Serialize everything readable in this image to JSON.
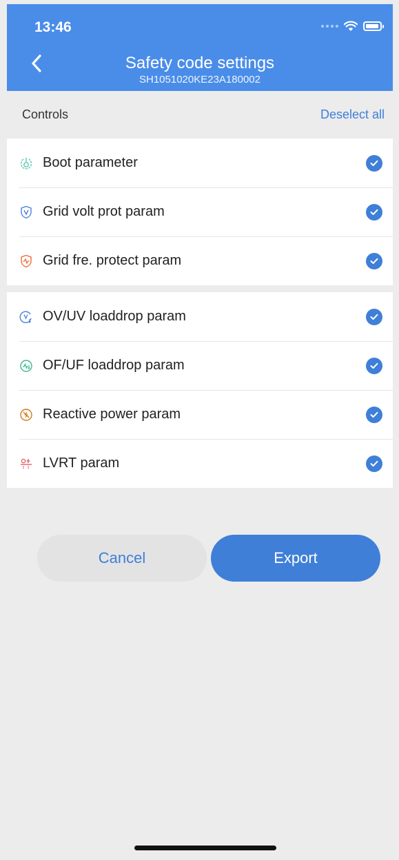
{
  "status_bar": {
    "time": "13:46"
  },
  "header": {
    "title": "Safety code settings",
    "subtitle": "SH1051020KE23A180002"
  },
  "section": {
    "label": "Controls",
    "action": "Deselect all"
  },
  "group1": [
    {
      "label": "Boot parameter",
      "icon": "power-plug-icon",
      "icon_color": "#5bc8b4",
      "checked": true
    },
    {
      "label": "Grid volt prot param",
      "icon": "voltage-shield-icon",
      "icon_color": "#4a7fe0",
      "checked": true
    },
    {
      "label": "Grid fre. protect param",
      "icon": "frequency-shield-icon",
      "icon_color": "#ee6a3a",
      "checked": true
    }
  ],
  "group2": [
    {
      "label": "OV/UV loaddrop param",
      "icon": "voltage-drop-icon",
      "icon_color": "#4a7fe0",
      "checked": true
    },
    {
      "label": "OF/UF loaddrop param",
      "icon": "frequency-drop-icon",
      "icon_color": "#3fb98a",
      "checked": true
    },
    {
      "label": "Reactive power param",
      "icon": "reactive-power-icon",
      "icon_color": "#d07a1c",
      "checked": true
    },
    {
      "label": "LVRT param",
      "icon": "lvrt-icon",
      "icon_color": "#e2535f",
      "checked": true
    }
  ],
  "buttons": {
    "cancel": "Cancel",
    "export": "Export"
  },
  "colors": {
    "header": "#4a8de9",
    "accent": "#3f7fd8",
    "background": "#ececec"
  }
}
